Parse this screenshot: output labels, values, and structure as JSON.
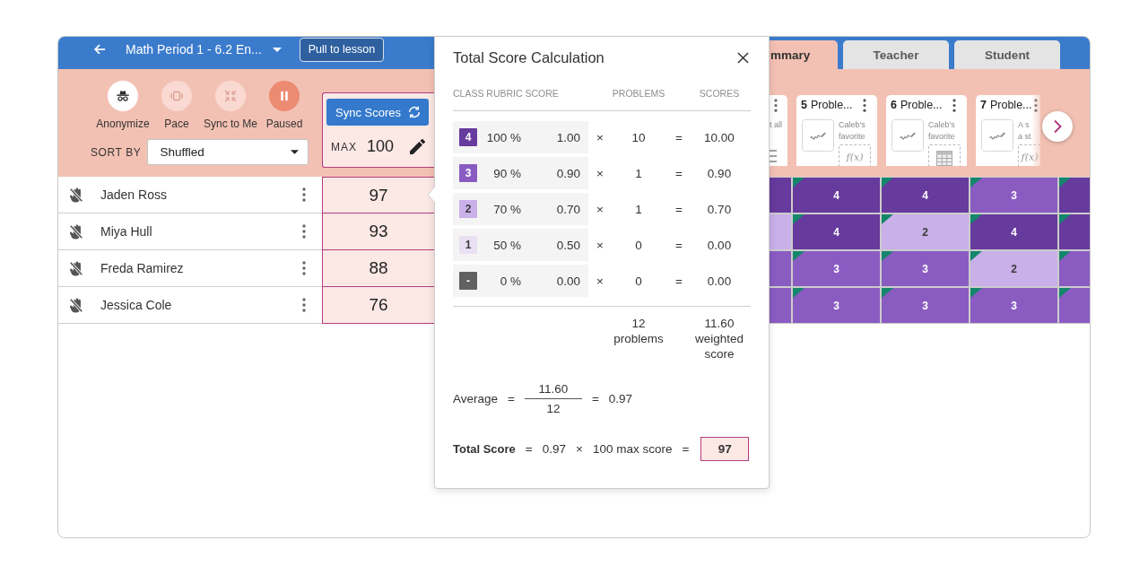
{
  "header": {
    "title": "Math Period 1 - 6.2 En...",
    "pull_button": "Pull to lesson"
  },
  "tabs": [
    {
      "label": "mmary",
      "selected": true
    },
    {
      "label": "Teacher",
      "selected": false
    },
    {
      "label": "Student",
      "selected": false
    }
  ],
  "tools": [
    {
      "kind": "anonymize",
      "label": "Anonymize",
      "active": false,
      "disabled": false
    },
    {
      "kind": "pace",
      "label": "Pace",
      "active": false,
      "disabled": true
    },
    {
      "kind": "sync",
      "label": "Sync to Me",
      "active": false,
      "disabled": true
    },
    {
      "kind": "pause",
      "label": "Paused",
      "active": true,
      "disabled": false
    }
  ],
  "sort": {
    "label": "SORT BY",
    "value": "Shuffled"
  },
  "score_header": {
    "sync_button": "Sync Scores",
    "max_label": "MAX",
    "max_value": "100"
  },
  "problem_strip": {
    "cut_card": {
      "text": "t all"
    },
    "cards": [
      {
        "number": "5",
        "title": "Proble...",
        "description_lines": [
          "Caleb's",
          "favorite"
        ],
        "attachment": {
          "kind": "function",
          "label": "f(x)"
        }
      },
      {
        "number": "6",
        "title": "Proble...",
        "description_lines": [
          "Caleb's",
          "favorite"
        ],
        "attachment": {
          "kind": "table"
        }
      },
      {
        "number": "7",
        "title": "Proble...",
        "description_lines": [
          "A s",
          "a st"
        ],
        "attachment": {
          "kind": "function",
          "label": "f(x)"
        }
      }
    ]
  },
  "students": [
    {
      "name": "Jaden Ross",
      "hand_raised": false,
      "score": "97",
      "cells": [
        {
          "color": "#673a9e",
          "flag": false
        },
        {
          "score": "4",
          "color": "#673a9e",
          "flag": true
        },
        {
          "score": "4",
          "color": "#673a9e",
          "flag": true
        },
        {
          "score": "3",
          "color": "#8a5cc2",
          "flag": true
        },
        {
          "color": "#673a9e",
          "flag": true
        }
      ]
    },
    {
      "name": "Miya Hull",
      "hand_raised": false,
      "score": "93",
      "cells": [
        {
          "color": "#c9b0e9",
          "flag": false
        },
        {
          "score": "4",
          "color": "#673a9e",
          "flag": true
        },
        {
          "score": "2",
          "color": "#c9b0e9",
          "flag": true
        },
        {
          "score": "4",
          "color": "#673a9e",
          "flag": true
        },
        {
          "color": "#673a9e",
          "flag": true
        }
      ]
    },
    {
      "name": "Freda Ramirez",
      "hand_raised": false,
      "score": "88",
      "cells": [
        {
          "color": "#8a5cc2",
          "flag": false
        },
        {
          "score": "3",
          "color": "#8a5cc2",
          "flag": true
        },
        {
          "score": "3",
          "color": "#8a5cc2",
          "flag": true
        },
        {
          "score": "2",
          "color": "#c9b0e9",
          "flag": true
        },
        {
          "color": "#8a5cc2",
          "flag": true
        }
      ]
    },
    {
      "name": "Jessica Cole",
      "hand_raised": false,
      "score": "76",
      "cells": [
        {
          "color": "#8a5cc2",
          "flag": false
        },
        {
          "score": "3",
          "color": "#8a5cc2",
          "flag": true
        },
        {
          "score": "3",
          "color": "#8a5cc2",
          "flag": true
        },
        {
          "score": "3",
          "color": "#8a5cc2",
          "flag": true
        },
        {
          "color": "#8a5cc2",
          "flag": true
        }
      ]
    }
  ],
  "popup": {
    "title": "Total Score Calculation",
    "columns": [
      "CLASS RUBRIC SCORE",
      "PROBLEMS",
      "SCORES"
    ],
    "rows": [
      {
        "badge": "4",
        "color": "#673a9e",
        "percent": "100 %",
        "weight": "1.00",
        "times": "×",
        "problems": "10",
        "equals": "=",
        "score": "10.00"
      },
      {
        "badge": "3",
        "color": "#8a5cc2",
        "percent": "90 %",
        "weight": "0.90",
        "times": "×",
        "problems": "1",
        "equals": "=",
        "score": "0.90"
      },
      {
        "badge": "2",
        "color": "#c9b0e9",
        "percent": "70 %",
        "weight": "0.70",
        "times": "×",
        "problems": "1",
        "equals": "=",
        "score": "0.70"
      },
      {
        "badge": "1",
        "color": "#e9e0f4",
        "percent": "50 %",
        "weight": "0.50",
        "times": "×",
        "problems": "0",
        "equals": "=",
        "score": "0.00"
      },
      {
        "badge": "-",
        "color": "#616161",
        "percent": "0 %",
        "weight": "0.00",
        "times": "×",
        "problems": "0",
        "equals": "=",
        "score": "0.00"
      }
    ],
    "totals": {
      "problems": "12",
      "problems_label": "problems",
      "score": "11.60",
      "score_label": "weighted score"
    },
    "average": {
      "label": "Average",
      "equals": "=",
      "numerator": "11.60",
      "denominator": "12",
      "equals_2": "=",
      "result": "0.97"
    },
    "total": {
      "label": "Total Score",
      "equals": "=",
      "average": "0.97",
      "times": "×",
      "max": "100 max score",
      "equals_2": "=",
      "result": "97"
    }
  }
}
